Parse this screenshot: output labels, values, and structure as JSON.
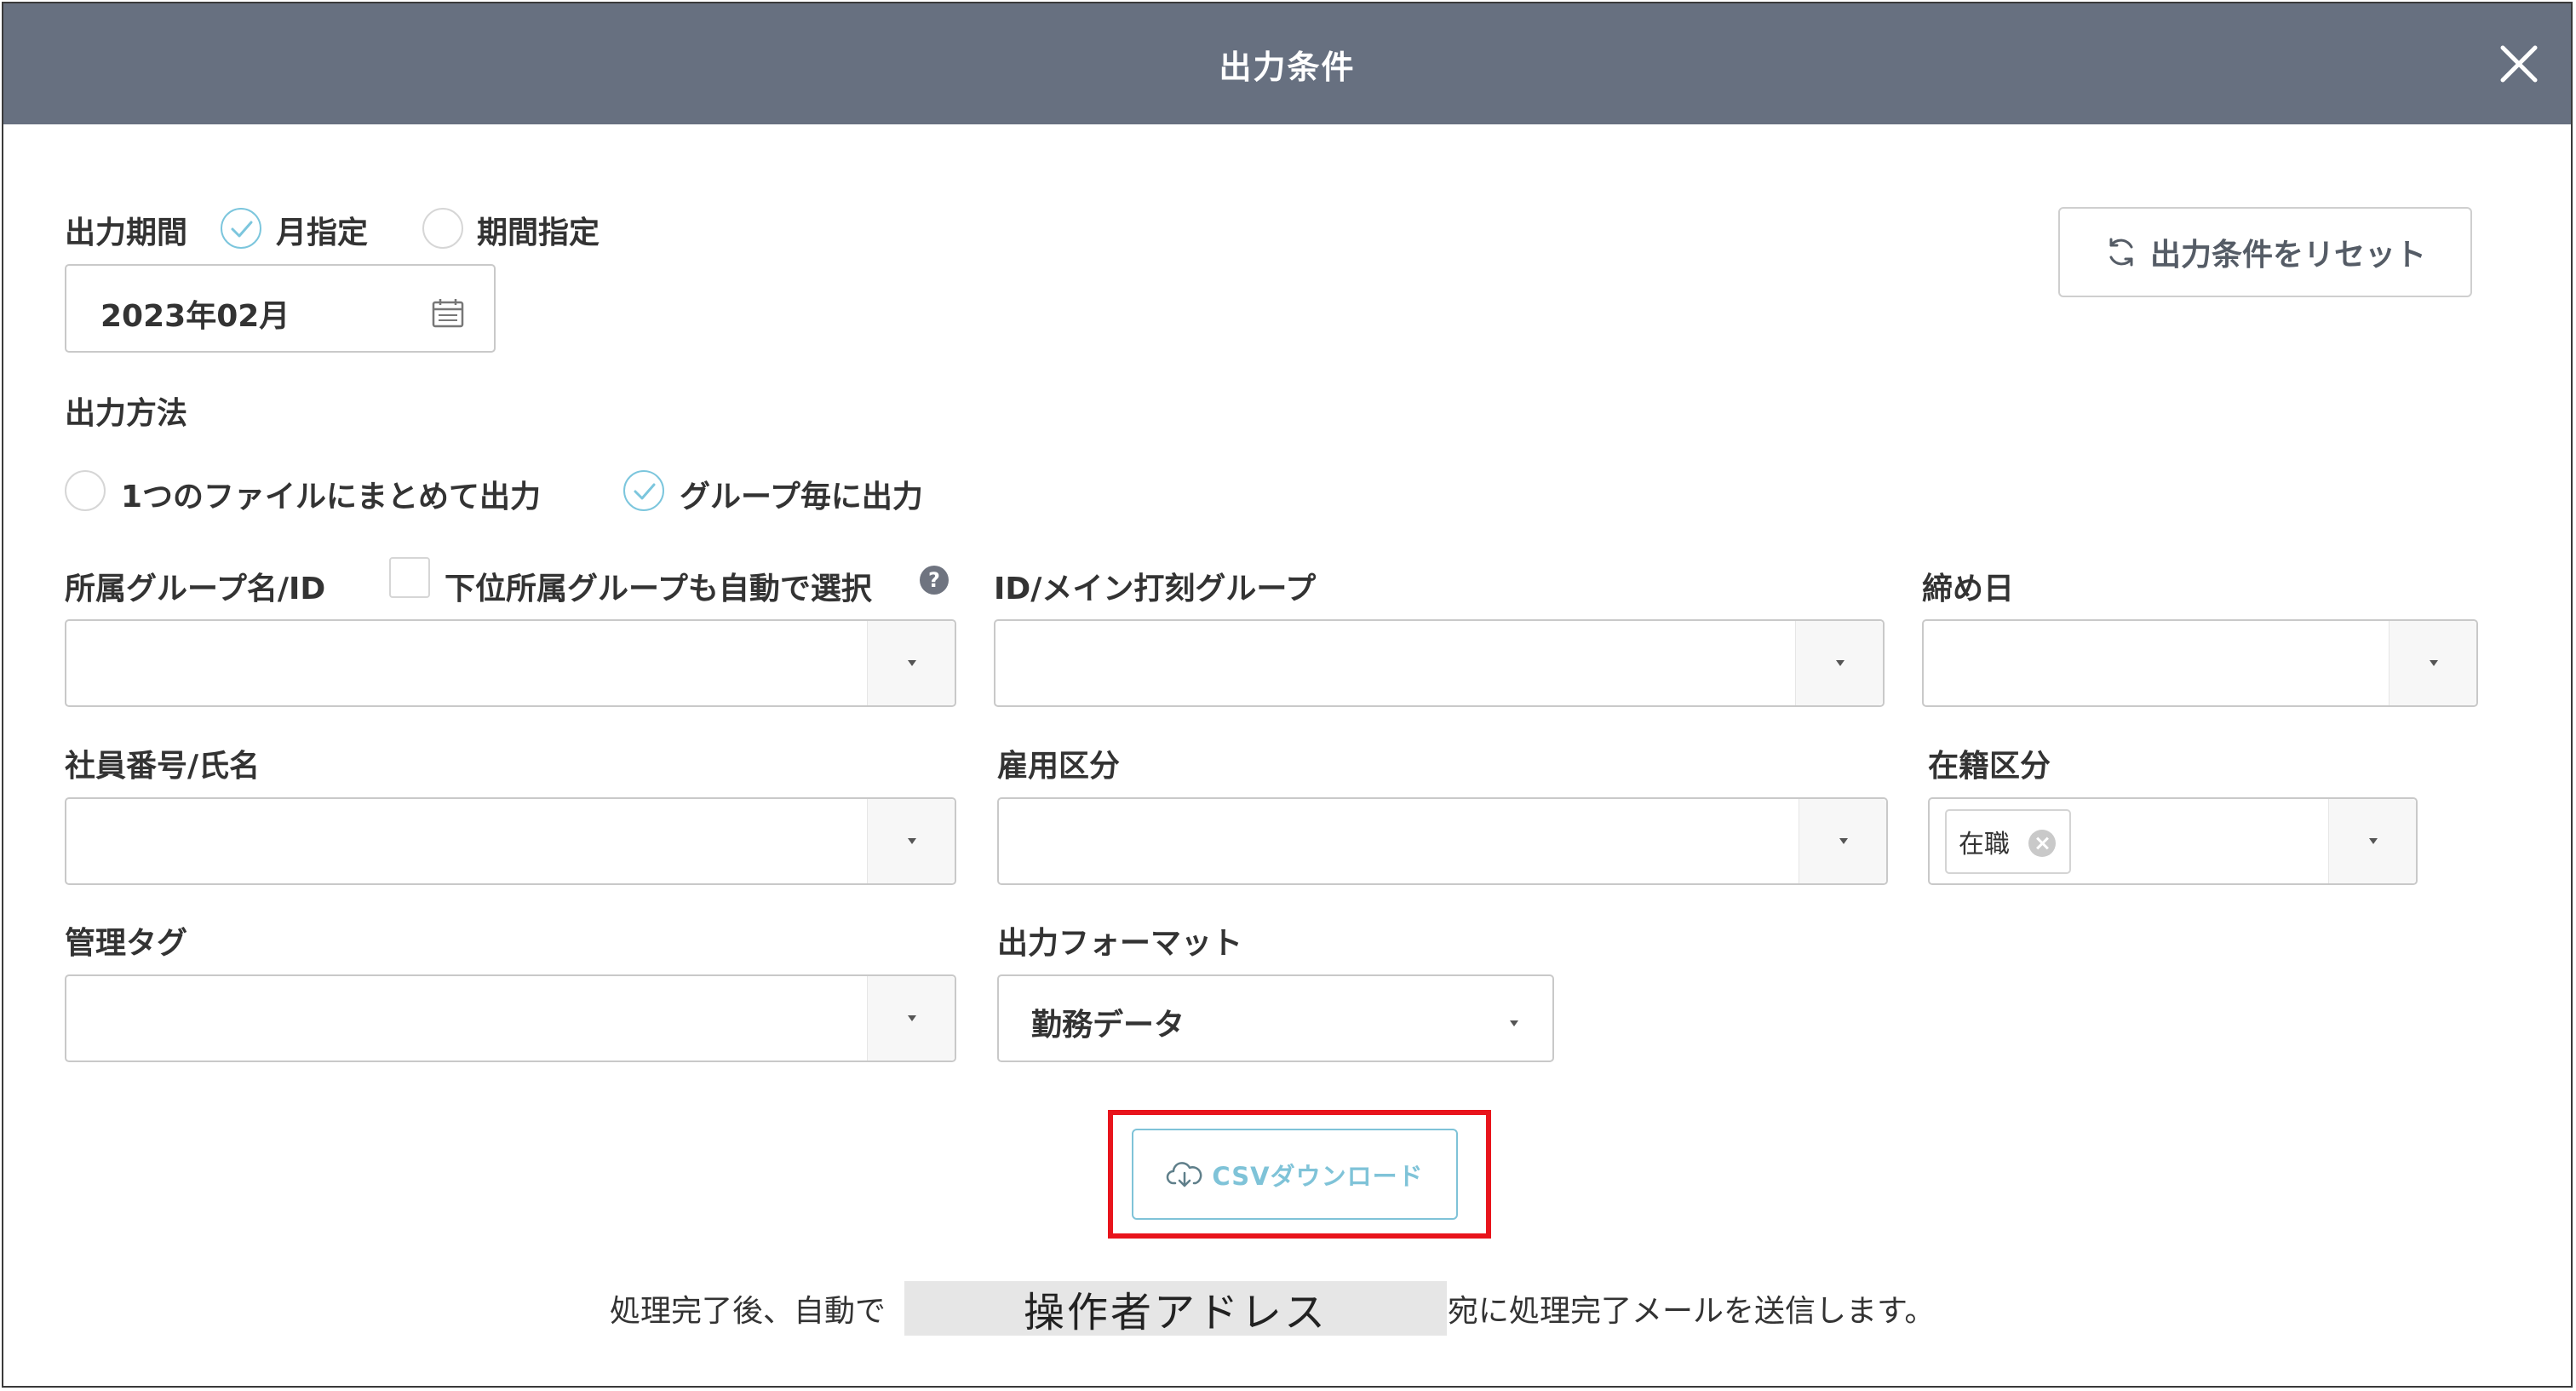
{
  "dialog": {
    "title": "出力条件"
  },
  "period": {
    "label": "出力期間",
    "option_month": "月指定",
    "option_range": "期間指定",
    "selected": "月指定",
    "month_value": "2023年02月"
  },
  "reset_button": {
    "label": "出力条件をリセット"
  },
  "method": {
    "label": "出力方法",
    "option_single": "1つのファイルにまとめて出力",
    "option_group": "グループ毎に出力",
    "selected": "グループ毎に出力"
  },
  "filters": {
    "group_label": "所属グループ名/ID",
    "sub_group_checkbox_label": "下位所属グループも自動で選択",
    "help_glyph": "?",
    "main_stamp_group_label": "ID/メイン打刻グループ",
    "closing_day_label": "締め日",
    "employee_label": "社員番号/氏名",
    "employment_type_label": "雇用区分",
    "status_label": "在籍区分",
    "status_tag": "在職",
    "management_tag_label": "管理タグ",
    "format_label": "出力フォーマット",
    "format_value": "勤務データ"
  },
  "download": {
    "label": "CSVダウンロード"
  },
  "footer": {
    "before": "処理完了後、自動で",
    "masked": "操作者アドレス",
    "after": "宛に処理完了メールを送信します。"
  },
  "colors": {
    "header_bg": "#677080",
    "accent": "#7fc3d8",
    "highlight": "#e8141c"
  }
}
